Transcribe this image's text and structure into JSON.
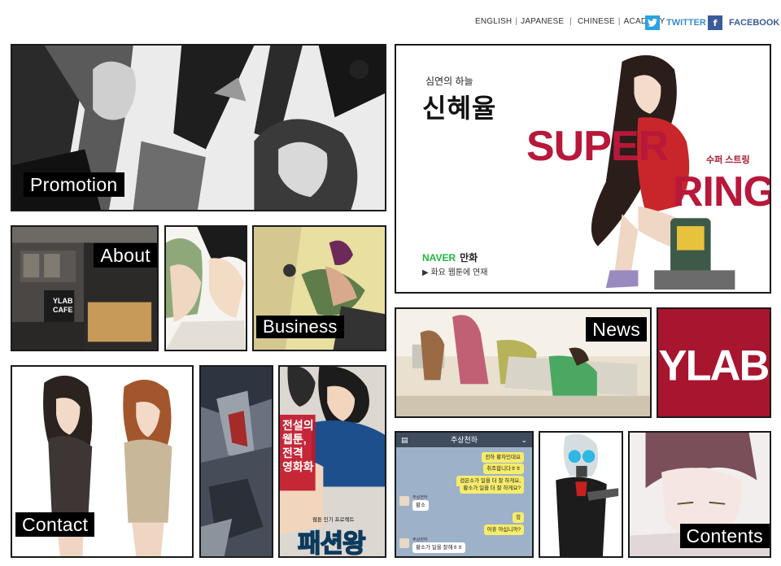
{
  "header": {
    "languages": [
      "ENGLISH",
      "JAPANESE",
      "CHINESE",
      "ACADEMY"
    ],
    "twitter_label": "TWITTER",
    "facebook_label": "FACEBOOK",
    "twitter_icon": "twitter-icon",
    "facebook_icon": "facebook-icon"
  },
  "tiles": {
    "promotion": "Promotion",
    "about": "About",
    "business": "Business",
    "news": "News",
    "contact": "Contact",
    "contents": "Contents"
  },
  "feature": {
    "subtitle": "심연의 하늘",
    "title": "신혜율",
    "series_word_top": "SUPER",
    "series_word_bottom": "RING",
    "korean_badge": "수퍼 스트링",
    "naver_brand": "NAVER",
    "naver_section": "만화",
    "schedule": "▶ 화요 웹툰에 연재"
  },
  "building_sign": [
    "YLAB",
    "CAFE"
  ],
  "ylab_logo": "YLAB",
  "fashion_tile": {
    "title_lines": [
      "전설의",
      "웹툰,",
      "전격",
      "영화화"
    ],
    "subtitle": "웹툰 인기 프로젝트",
    "logo": "패션왕"
  },
  "chat": {
    "title": "주상천하",
    "messages": [
      {
        "side": "me",
        "text": "전하 황차인대요"
      },
      {
        "side": "me",
        "text": "취조합니다ㅎㅎ"
      },
      {
        "side": "me",
        "text": "검은소가 일을 더 잘 하게요,"
      },
      {
        "side": "me",
        "text": "황소가 일을 더 잘 하게요?"
      },
      {
        "side": "you",
        "name": "주상전하",
        "text": "황소"
      },
      {
        "side": "me",
        "text": "힝"
      },
      {
        "side": "me",
        "text": "어휴 아십니까?"
      },
      {
        "side": "you",
        "name": "주상전하",
        "text": "황소가 일을 잘해ㅎㅎ"
      }
    ]
  },
  "colors": {
    "brand_red": "#a8152e",
    "twitter_blue": "#2aa3e6",
    "facebook_blue": "#3b5b9a",
    "naver_green": "#1fb844",
    "tile_border": "#1a1a1a"
  }
}
